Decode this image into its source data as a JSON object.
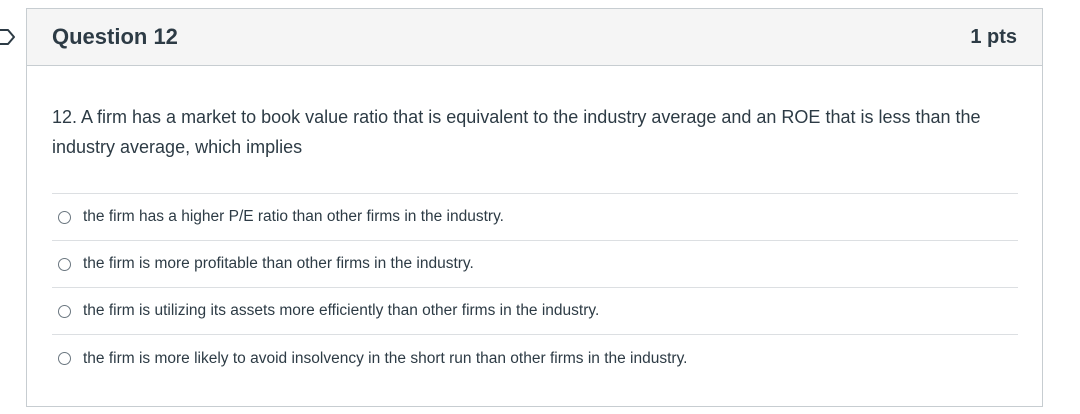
{
  "question": {
    "title": "Question 12",
    "points": "1 pts",
    "text": "12. A firm has a market to book value ratio that is equivalent to the industry average and an ROE that is less than the industry average, which implies",
    "flag_icon": "bookmark-flag-icon",
    "answers": [
      {
        "label": "the firm has a higher P/E ratio than other firms in the industry.",
        "selected": false
      },
      {
        "label": "the firm is more profitable than other firms in the industry.",
        "selected": false
      },
      {
        "label": "the firm is utilizing its assets more efficiently than other firms in the industry.",
        "selected": false
      },
      {
        "label": "the firm is more likely to avoid insolvency in the short run than other firms in the industry.",
        "selected": false
      }
    ]
  },
  "colors": {
    "header_bg": "#f5f5f5",
    "border": "#c7cdd1",
    "text": "#2d3b45"
  }
}
